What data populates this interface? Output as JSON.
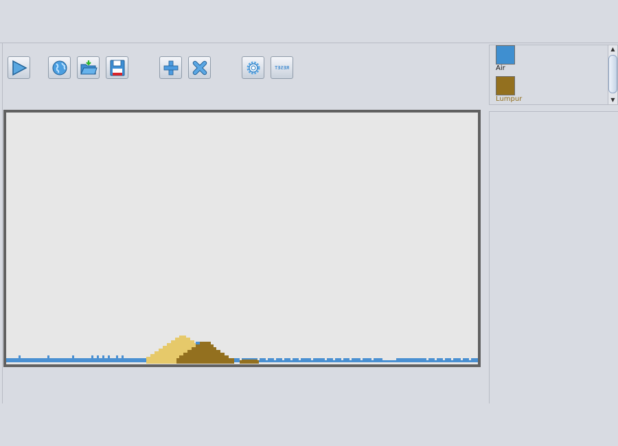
{
  "toolbar": {
    "buttons": [
      {
        "id": "play",
        "icon": "play-icon",
        "tooltip": "Play"
      },
      {
        "id": "world",
        "icon": "globe-icon",
        "tooltip": "World"
      },
      {
        "id": "open",
        "icon": "folder-open-icon",
        "tooltip": "Open"
      },
      {
        "id": "save",
        "icon": "floppy-disk-icon",
        "tooltip": "Save"
      },
      {
        "id": "add",
        "icon": "plus-icon",
        "tooltip": "Add element"
      },
      {
        "id": "remove",
        "icon": "close-x-icon",
        "tooltip": "Remove element"
      },
      {
        "id": "settings",
        "icon": "gear-icon",
        "tooltip": "Settings"
      },
      {
        "id": "reset",
        "icon": "reset-text-icon",
        "label": "RESET"
      }
    ]
  },
  "palette": {
    "items": [
      {
        "label": "Air",
        "color": "#3f8fd0",
        "label_color": "#111111"
      },
      {
        "label": "Lumpur",
        "color": "#93701f",
        "label_color": "#93701f"
      }
    ]
  },
  "colors": {
    "water": "#4a90d2",
    "sand": "#e6c96a",
    "mud": "#93701f",
    "canvas_bg": "#e7e7e7",
    "canvas_border": "#616161"
  }
}
